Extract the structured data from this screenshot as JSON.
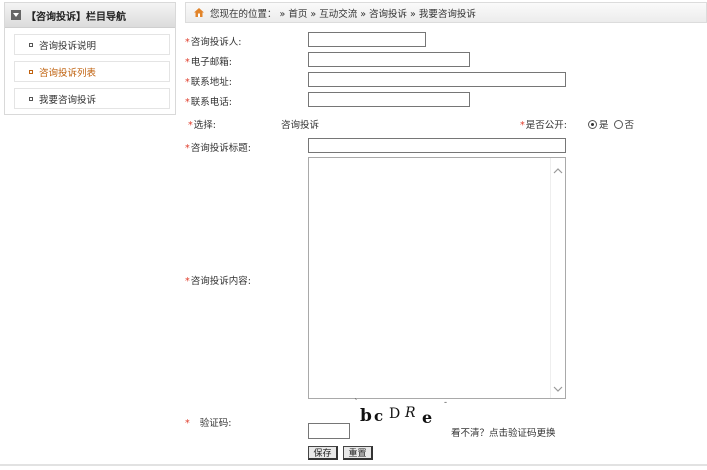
{
  "sidebar": {
    "title": "【咨询投诉】栏目导航",
    "items": [
      {
        "label": "咨询投诉说明"
      },
      {
        "label": "咨询投诉列表"
      },
      {
        "label": "我要咨询投诉"
      }
    ]
  },
  "breadcrumb": {
    "prefix": "您现在的位置：",
    "items": [
      "» 首页",
      "» 互动交流",
      "» 咨询投诉",
      "» 我要咨询投诉"
    ]
  },
  "form": {
    "req_mark": "*",
    "name_label": "咨询投诉人:",
    "email_label": "电子邮箱:",
    "address_label": "联系地址:",
    "phone_label": "联系电话:",
    "select_label": "选择:",
    "select_value": "咨询投诉",
    "public_label": "是否公开:",
    "public_options": [
      "是",
      "否"
    ],
    "subject_label": "咨询投诉标题:",
    "content_label": "咨询投诉内容:",
    "captcha_label": "验证码:",
    "captcha_chars": [
      "b",
      "c",
      "D",
      "R",
      "e"
    ],
    "captcha_hint": "看不清？点击验证码更换",
    "name_value": "",
    "email_value": "",
    "address_value": "",
    "phone_value": "",
    "subject_value": "",
    "captcha_value": ""
  },
  "buttons": {
    "save": "保存",
    "reset": "重置"
  },
  "colors": {
    "required": "#e03c2a",
    "active_nav": "#c0620f"
  }
}
